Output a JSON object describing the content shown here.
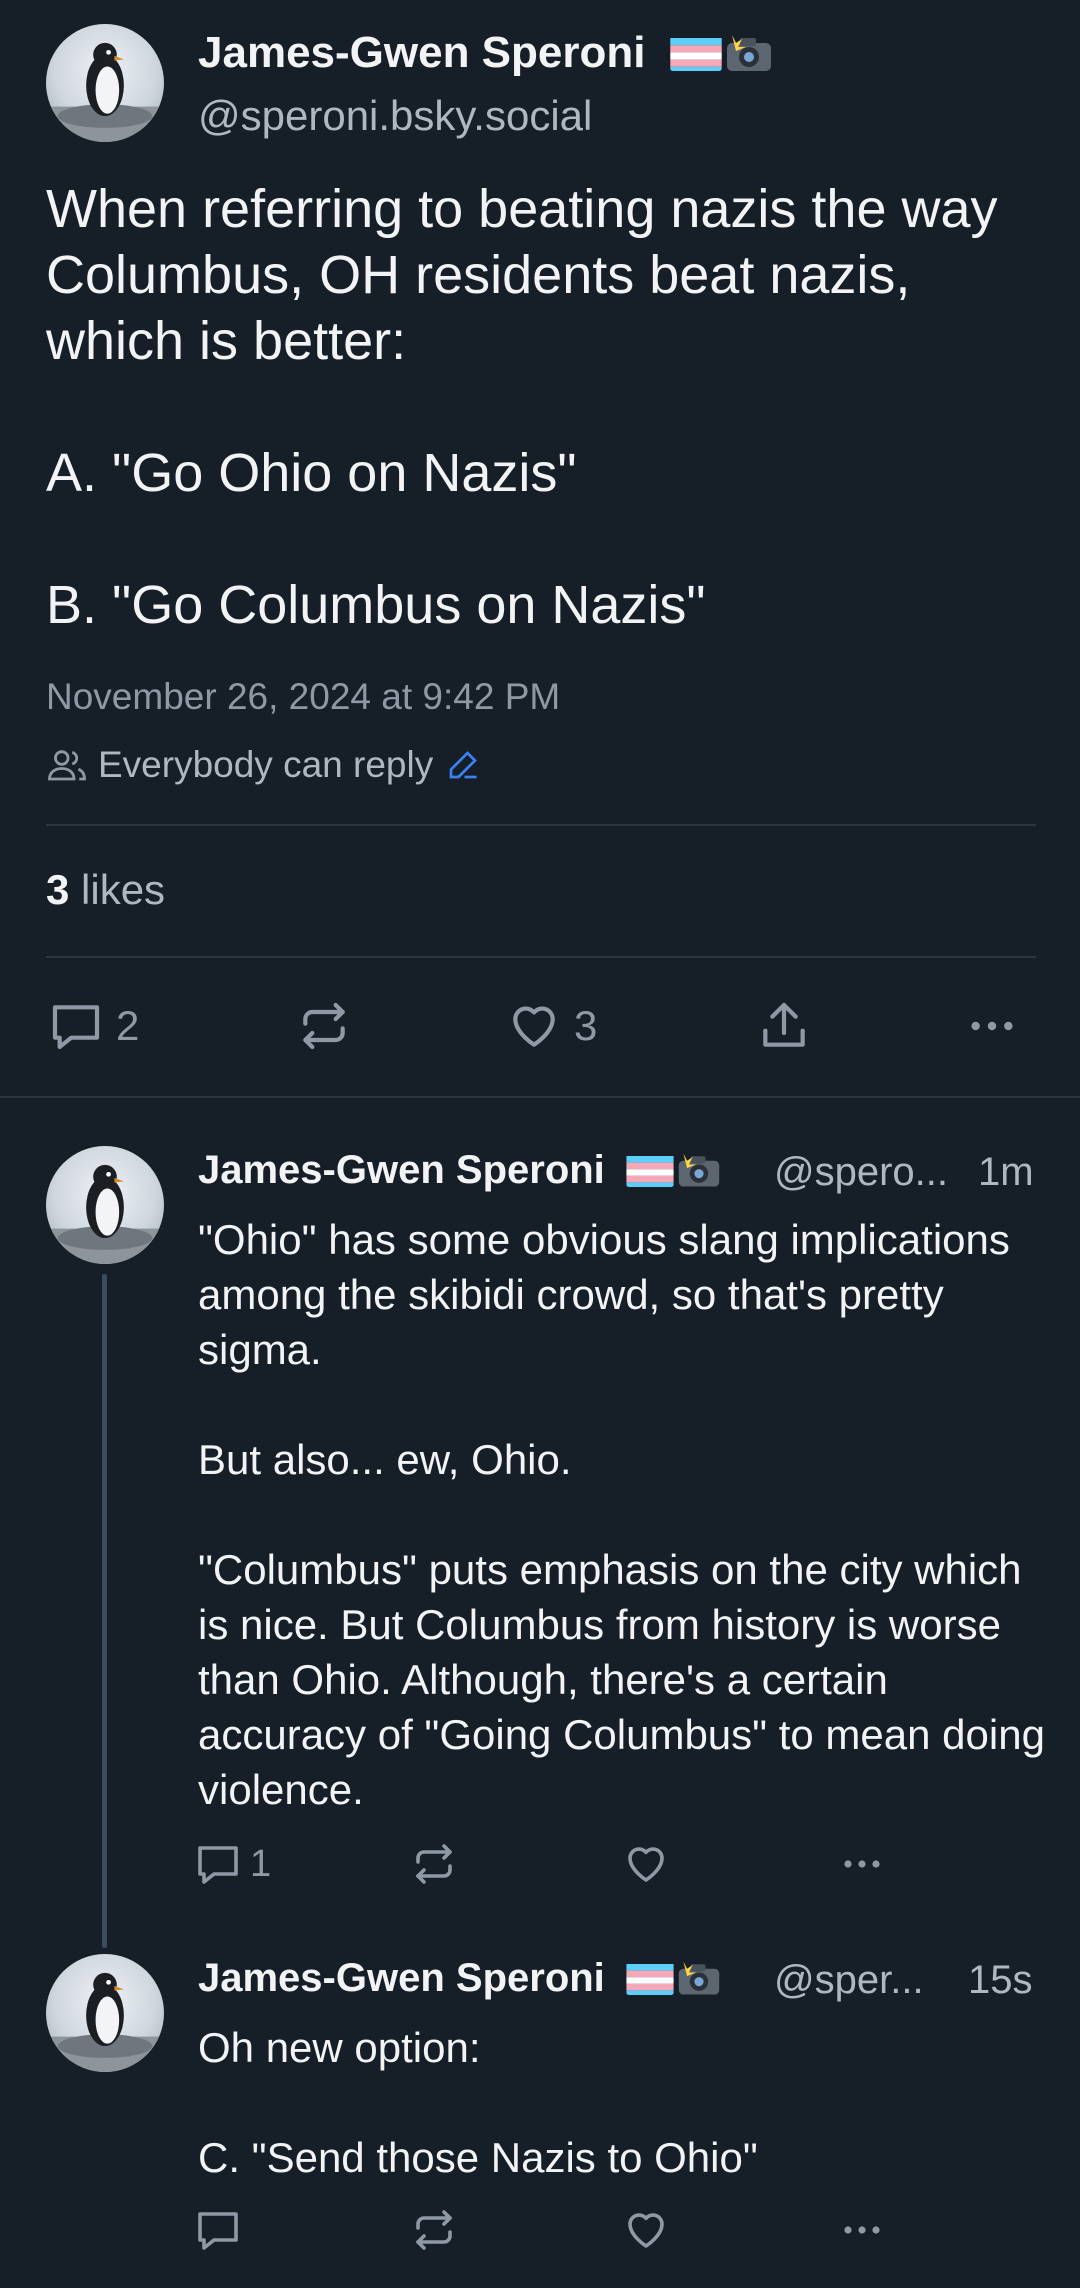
{
  "post": {
    "author_name": "James-Gwen Speroni",
    "author_handle": "@speroni.bsky.social",
    "text": "When referring to beating nazis the way Columbus, OH residents beat nazis, which is better:\n\nA. \"Go Ohio on Nazis\"\n\nB. \"Go Columbus on Nazis\"",
    "timestamp": "November 26, 2024 at 9:42 PM",
    "reply_permission": "Everybody can reply",
    "likes_count": "3",
    "likes_label": "likes",
    "actions": {
      "reply_count": "2",
      "like_count": "3"
    }
  },
  "replies": [
    {
      "author_name": "James-Gwen Speroni",
      "handle": "@spero...",
      "time": "1m",
      "text": "\"Ohio\" has some obvious slang implications among the skibidi crowd, so that's pretty sigma.\n\nBut also... ew, Ohio.\n\n\"Columbus\" puts emphasis on the city which is nice. But Columbus from history is worse than Ohio. Although, there's a certain accuracy of \"Going Columbus\" to mean doing violence.",
      "reply_count": "1"
    },
    {
      "author_name": "James-Gwen Speroni",
      "handle": "@sper...",
      "time": "15s",
      "text": "Oh new option:\n\nC. \"Send those Nazis to Ohio\""
    }
  ],
  "icons": {
    "reply": "comment-icon",
    "repost": "repost-icon",
    "like": "heart-icon",
    "share": "share-icon",
    "more": "more-icon",
    "people": "people-icon",
    "edit": "pencil-icon"
  },
  "colors": {
    "background": "#161e27",
    "muted_text": "#8e99a5",
    "accent": "#3b82f6"
  }
}
